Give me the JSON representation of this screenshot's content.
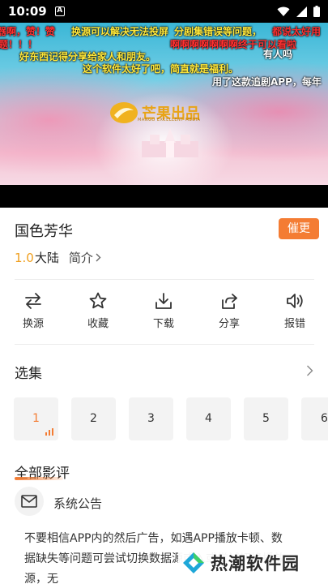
{
  "status_bar": {
    "time": "10:09",
    "notification_letter": "A"
  },
  "video": {
    "logo_text": "芒果出品",
    "logo_subtext": "MANGO EXCELLENT MEDIA",
    "danmaku": [
      {
        "text": "器啊，赞！赞",
        "color": "red"
      },
      {
        "text": "换源可以解决无法投屏",
        "color": "yellow"
      },
      {
        "text": "分剧集错误等问题，",
        "color": "yellow"
      },
      {
        "text": "都说太好用",
        "color": "red"
      },
      {
        "text": "题！！！",
        "color": "red"
      },
      {
        "text": "啊啊啊啊啊啊啊终于可以看啦",
        "color": "red"
      },
      {
        "text": "好东西记得分享给家人和朋友。",
        "color": "yellow"
      },
      {
        "text": "有人吗",
        "color": "white"
      },
      {
        "text": "这个软件太好了吧，简直就是福利。",
        "color": "yellow"
      },
      {
        "text": "用了这款追剧APP，每年",
        "color": "white"
      }
    ]
  },
  "show": {
    "title": "国色芳华",
    "urge_label": "催更",
    "rating": "1.0",
    "region": "大陆",
    "intro_label": "简介"
  },
  "actions": [
    {
      "label": "换源",
      "icon": "swap-icon"
    },
    {
      "label": "收藏",
      "icon": "star-icon"
    },
    {
      "label": "下载",
      "icon": "download-icon"
    },
    {
      "label": "分享",
      "icon": "share-icon"
    },
    {
      "label": "报错",
      "icon": "speaker-icon"
    }
  ],
  "episodes": {
    "title": "选集",
    "items": [
      "1",
      "2",
      "3",
      "4",
      "5",
      "6"
    ],
    "active": "1"
  },
  "comments": {
    "title": "全部影评",
    "notice_title": "系统公告",
    "notice_text": "不要相信APP内的然后广告，如遇APP播放卡顿、数据缺失等问题可尝试切换数据源或入或尝试切换播放源，无"
  },
  "watermark": {
    "text": "热潮软件园"
  }
}
